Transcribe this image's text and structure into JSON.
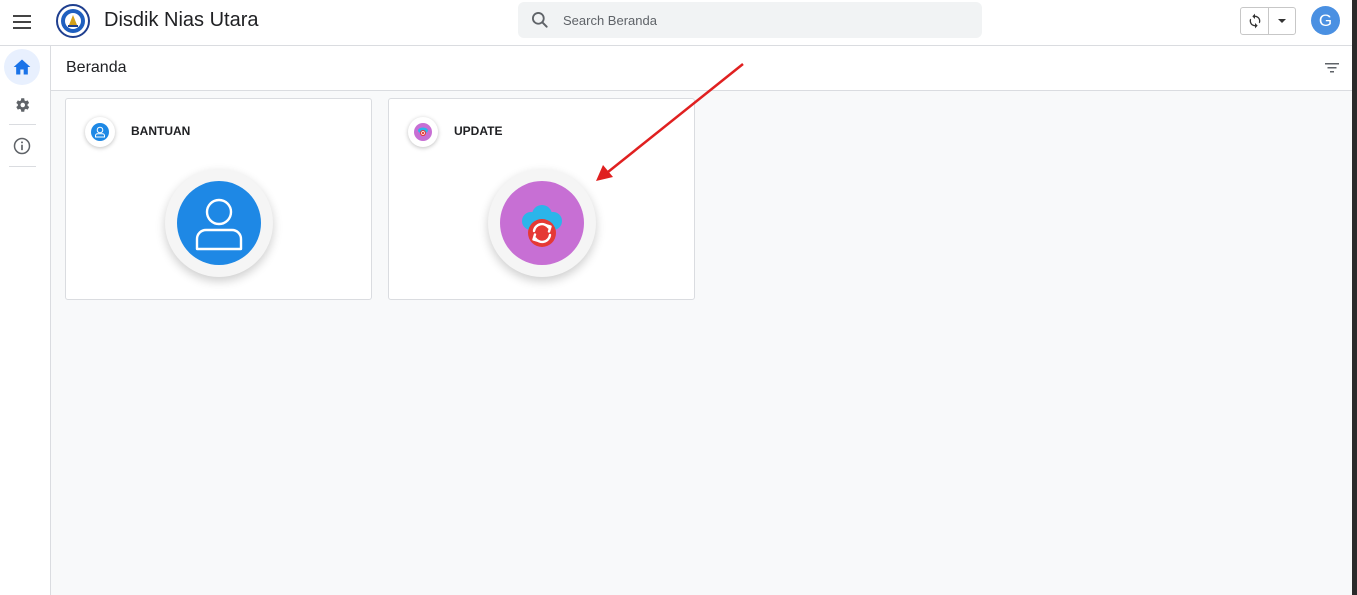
{
  "header": {
    "app_title": "Disdik Nias Utara",
    "search_placeholder": "Search Beranda",
    "avatar_letter": "G"
  },
  "sidebar": {
    "items": [
      {
        "name": "home",
        "icon": "home-icon",
        "active": true
      },
      {
        "name": "settings",
        "icon": "gear-icon",
        "active": false
      },
      {
        "name": "info",
        "icon": "info-icon",
        "active": false
      }
    ]
  },
  "main": {
    "page_title": "Beranda",
    "cards": [
      {
        "title": "BANTUAN",
        "icon": "user-icon",
        "color": "#1e88e5"
      },
      {
        "title": "UPDATE",
        "icon": "cloud-sync-icon",
        "color": "#c76fd4"
      }
    ]
  },
  "colors": {
    "accent": "#1a73e8",
    "annotation_arrow": "#e02020",
    "avatar": "#4a90e2"
  }
}
